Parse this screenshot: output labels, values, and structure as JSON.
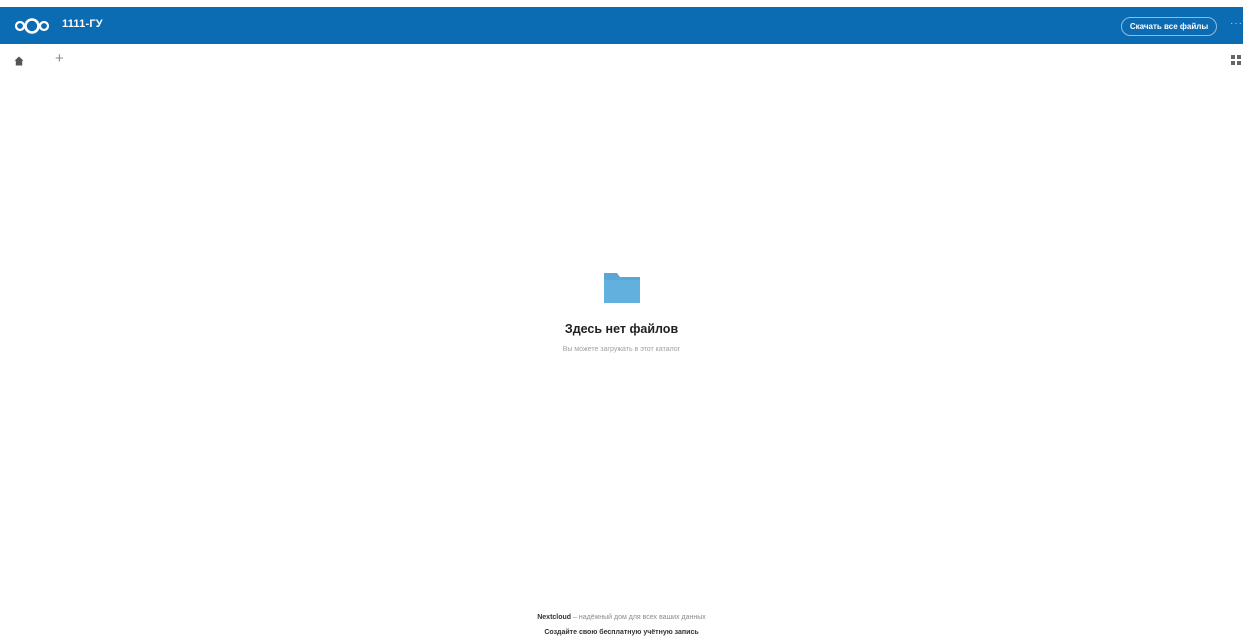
{
  "header": {
    "title": "1111-ГУ",
    "download_all_label": "Скачать все файлы",
    "more_label": "···",
    "brand_color": "#0b6bb3"
  },
  "breadcrumb": {
    "home_icon": "home-icon",
    "add_label": "+",
    "view_icon": "grid-view-icon"
  },
  "empty_state": {
    "icon": "folder-icon",
    "title": "Здесь нет файлов",
    "subtitle": "Вы можете загружать в этот каталог"
  },
  "footer": {
    "brand": "Nextcloud",
    "tagline": " – надёжный дом для всех ваших данных",
    "signup_link": "Создайте свою бесплатную учётную запись"
  }
}
